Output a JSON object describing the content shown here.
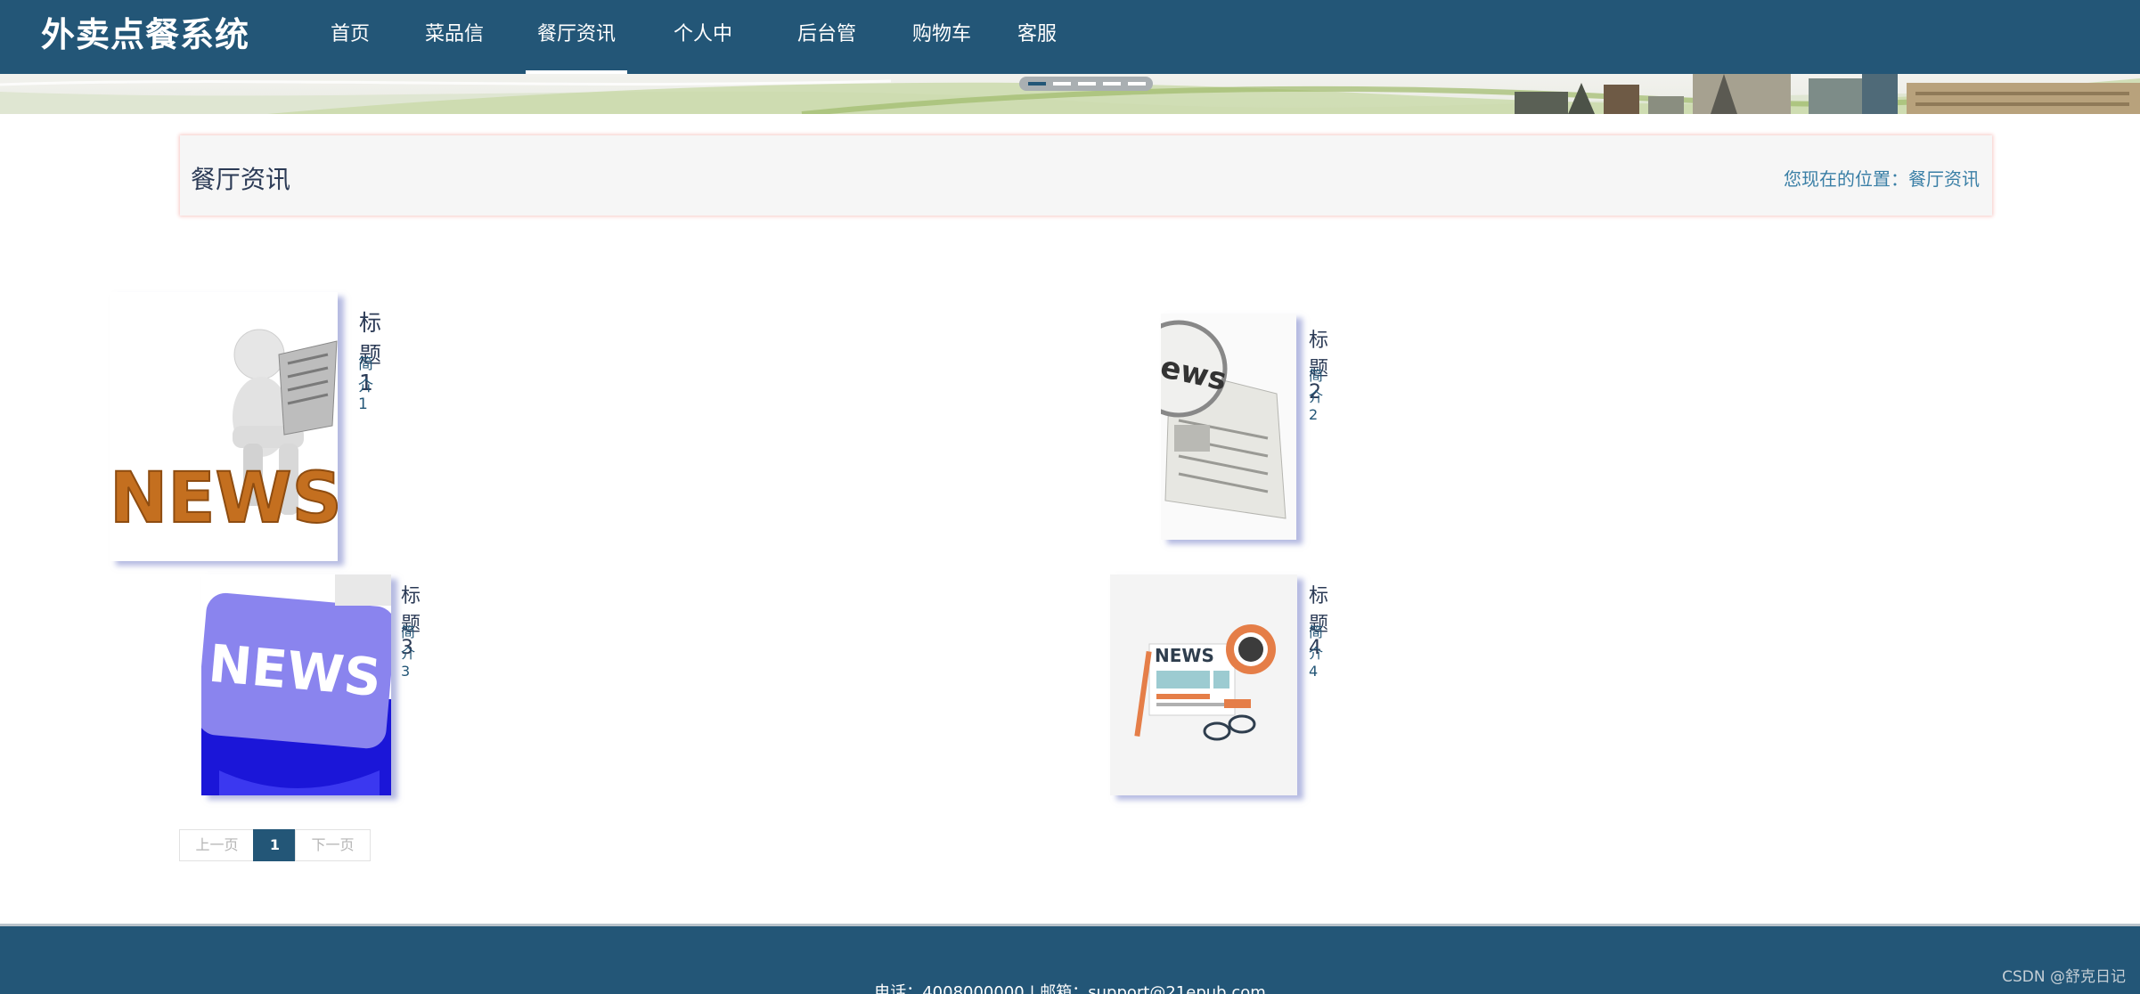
{
  "header": {
    "brand": "外卖点餐系统",
    "nav": [
      {
        "label": "首页"
      },
      {
        "label": "菜品信息"
      },
      {
        "label": "餐厅资讯",
        "active": true
      },
      {
        "label": "个人中心"
      },
      {
        "label": "后台管理"
      },
      {
        "label": "购物车"
      },
      {
        "label": "客服"
      }
    ]
  },
  "carousel": {
    "slide_count": 5,
    "active_index": 0
  },
  "location": {
    "page_title": "餐厅资讯",
    "crumb": "您现在的位置：餐厅资讯"
  },
  "news": [
    {
      "title": "标题1",
      "intro": "简介1",
      "image": "news-3d-figure-reading"
    },
    {
      "title": "标题2",
      "intro": "简介2",
      "image": "news-magnifier-newspaper"
    },
    {
      "title": "标题3",
      "intro": "简介3",
      "image": "news-blue-tag"
    },
    {
      "title": "标题4",
      "intro": "简介4",
      "image": "news-flat-newspaper-coffee"
    }
  ],
  "pagination": {
    "prev": "上一页",
    "current": "1",
    "next": "下一页"
  },
  "footer": {
    "contact": "电话：4008000000 | 邮箱：support@21epub.com"
  },
  "watermark": "CSDN @舒克日记",
  "colors": {
    "primary": "#235677",
    "page_bg": "#ffffff",
    "loc_bg": "#f6f6f6"
  }
}
